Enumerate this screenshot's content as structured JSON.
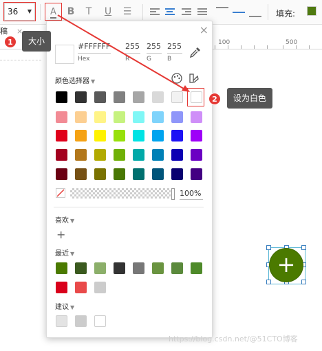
{
  "toolbar": {
    "font_size": "36",
    "fill_label": "填充:",
    "fill_color": "#4f7a10",
    "buttons": [
      {
        "name": "font-color-icon",
        "glyph": "A"
      },
      {
        "name": "bold-icon",
        "glyph": "B"
      },
      {
        "name": "strike-icon",
        "glyph": "T"
      },
      {
        "name": "underline-icon",
        "glyph": "U"
      },
      {
        "name": "list-icon",
        "glyph": "≡"
      }
    ]
  },
  "document": {
    "tab_label": "稿",
    "ruler_labels": [
      "100",
      "500"
    ]
  },
  "picker": {
    "hex_value": "#FFFFFF",
    "hex_label": "Hex",
    "r_value": "255",
    "r_label": "R",
    "g_value": "255",
    "g_label": "G",
    "b_value": "255",
    "b_label": "B",
    "selector_label": "颜色选择器",
    "opacity": "100%",
    "favorites_label": "喜欢",
    "recent_label": "最近",
    "suggest_label": "建议",
    "palette": [
      [
        "#000000",
        "#333333",
        "#595959",
        "#808080",
        "#a6a6a6",
        "#d9d9d9",
        "#f2f2f2",
        "#ffffff"
      ],
      [
        "#f28b95",
        "#fccf92",
        "#fff487",
        "#c6f27f",
        "#7ff7f6",
        "#7fd3fb",
        "#8f96f9",
        "#cf8ff8"
      ],
      [
        "#e0001b",
        "#f5a214",
        "#fff200",
        "#97e00a",
        "#00e3e4",
        "#00a4ef",
        "#1d12f5",
        "#9e00f8"
      ],
      [
        "#a3001f",
        "#b2771b",
        "#b2aa00",
        "#6fb006",
        "#01a9a8",
        "#0080b6",
        "#0c00b3",
        "#6b00c3"
      ],
      [
        "#6a0012",
        "#765014",
        "#7a7200",
        "#497703",
        "#00706f",
        "#00547a",
        "#090070",
        "#430082"
      ]
    ],
    "recent_colors": [
      [
        "#4b7a00",
        "#3b5a1f",
        "#8caf6a",
        "#333333",
        "#777777",
        "#6a9440",
        "#5b8a3c",
        "#4e8a2a"
      ],
      [
        "#d9001b",
        "#e94a4a",
        "#cccccc"
      ]
    ],
    "suggested_colors": [
      "#e3e3e3",
      "#cccccc",
      "#ffffff"
    ]
  },
  "callouts": {
    "step1_number": "1",
    "step1_text": "大小",
    "step2_number": "2",
    "step2_text": "设为白色"
  },
  "canvas": {
    "node_symbol": "+"
  },
  "watermark": "https://blog.csdn.net/@51CTO博客"
}
